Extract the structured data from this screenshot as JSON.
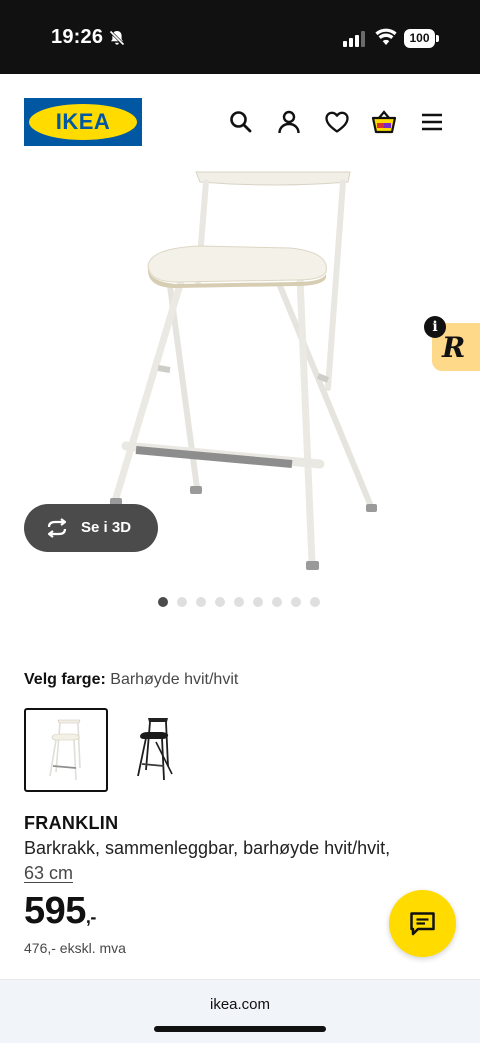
{
  "status_bar": {
    "time": "19:26",
    "battery": "100"
  },
  "header": {
    "logo_text": "IKEA",
    "icons": [
      "search-icon",
      "account-icon",
      "heart-icon",
      "basket-icon",
      "menu-icon"
    ]
  },
  "gallery": {
    "view_3d_label": "Se i 3D",
    "dots_count": 9,
    "active_dot": 0
  },
  "color_picker": {
    "label": "Velg farge:",
    "value": "Barhøyde hvit/hvit",
    "swatches": [
      "white",
      "black"
    ]
  },
  "product": {
    "name": "FRANKLIN",
    "description": "Barkrakk, sammenleggbar, barhøyde hvit/hvit,",
    "size": "63 cm",
    "price": "595",
    "price_suffix": ",-",
    "price_ex_vat": "476,- ekskl. mva"
  },
  "browser": {
    "url": "ikea.com"
  },
  "colors": {
    "ikea_blue": "#0058a3",
    "ikea_yellow": "#ffdb00",
    "status_bar": "#111111"
  }
}
